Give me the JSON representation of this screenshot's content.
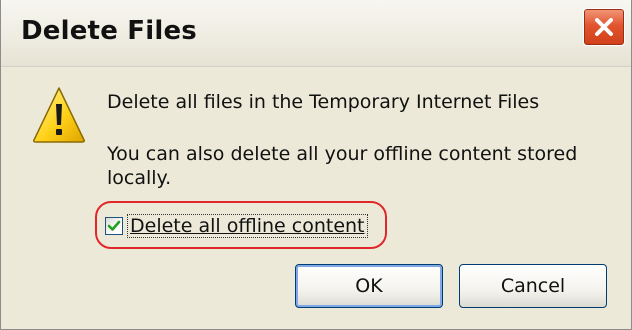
{
  "window": {
    "title": "Delete Files",
    "close_icon": "close-icon"
  },
  "message": {
    "icon": "warning-icon",
    "line1": "Delete all files in the Temporary Internet Files",
    "line2": "You can also delete all your offline content stored locally."
  },
  "option": {
    "label": "Delete all offline content",
    "checked": true,
    "highlight_color": "#e0282a"
  },
  "buttons": {
    "ok_label": "OK",
    "cancel_label": "Cancel"
  },
  "colors": {
    "dialog_bg": "#ece9d8",
    "close_button": "#e2552f",
    "checkmark": "#21a121",
    "button_border": "#003c74"
  }
}
